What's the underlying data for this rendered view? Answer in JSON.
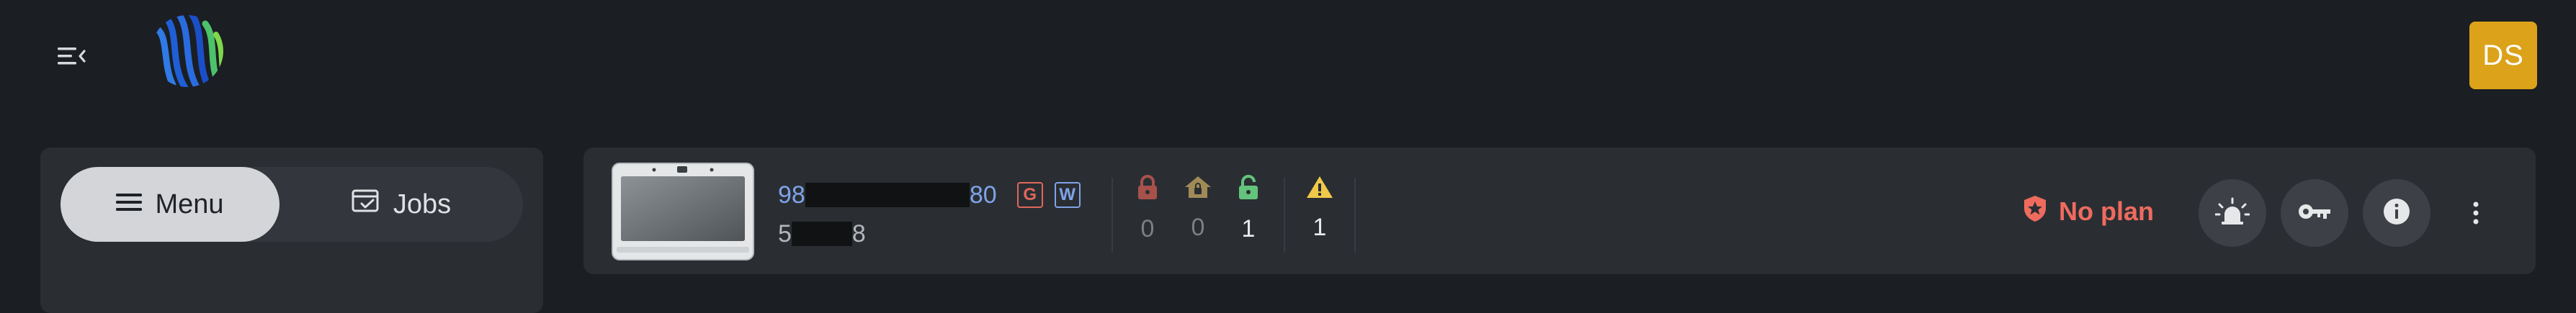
{
  "header": {
    "menu_toggle_icon": "menu-collapse-icon",
    "logo_icon": "brand-logo-icon",
    "avatar_initials": "DS",
    "avatar_color": "#dba21a"
  },
  "nav": {
    "tabs": [
      {
        "label": "Menu",
        "icon": "hamburger-icon",
        "active": true
      },
      {
        "label": "Jobs",
        "icon": "clipboard-check-icon",
        "active": false
      }
    ]
  },
  "device": {
    "image_icon": "tablet-device-icon",
    "serial_prefix": "98",
    "serial_suffix": "80",
    "tags": [
      "G",
      "W"
    ],
    "model_prefix": "5",
    "model_suffix": "8",
    "counts": {
      "locked": "0",
      "home_locked": "0",
      "unlocked": "1",
      "warnings": "1"
    },
    "plan_status": "No plan",
    "colors": {
      "serial": "#7ea4e8",
      "tag_g": "#e0675b",
      "tag_w": "#7ea4e8",
      "locked": "#a7514b",
      "home_locked": "#a08a56",
      "unlocked": "#64c37c",
      "warning": "#f0c94a",
      "plan_status": "#ee6b5e"
    }
  },
  "actions": [
    {
      "name": "alarm",
      "icon": "siren-icon"
    },
    {
      "name": "key",
      "icon": "key-icon"
    },
    {
      "name": "info",
      "icon": "info-icon"
    },
    {
      "name": "more",
      "icon": "more-vertical-icon"
    }
  ]
}
